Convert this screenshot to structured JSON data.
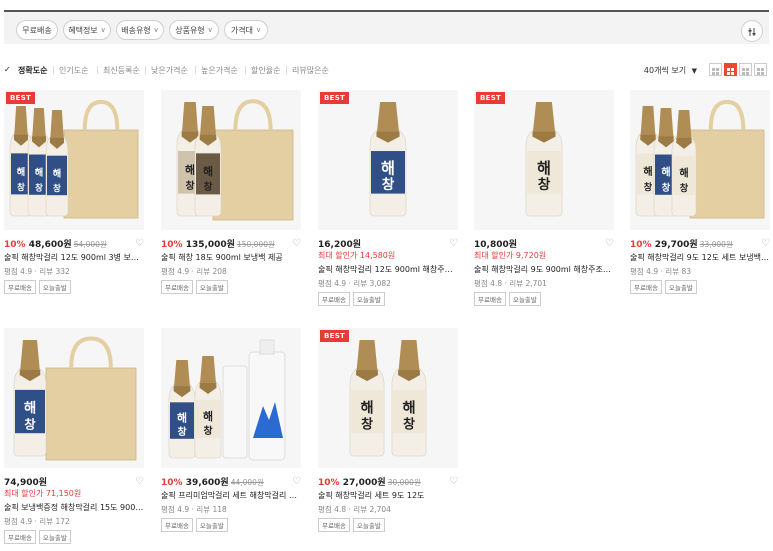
{
  "filters": [
    {
      "label": "무료배송",
      "chevron": false
    },
    {
      "label": "혜택정보",
      "chevron": true
    },
    {
      "label": "배송유형",
      "chevron": true
    },
    {
      "label": "상품유형",
      "chevron": true
    },
    {
      "label": "가격대",
      "chevron": true
    }
  ],
  "sort": {
    "options": [
      "정확도순",
      "인기도순",
      "최신등록순",
      "낮은가격순",
      "높은가격순",
      "할인율순",
      "리뷰많은순"
    ],
    "active": "정확도순",
    "per_page": "40개씩 보기"
  },
  "products": [
    {
      "best": "BEST",
      "discount": "10%",
      "price": "48,600원",
      "original": "54,000원",
      "max_label": "",
      "max_value": "",
      "name": "술픽 해창막걸리 12도 900ml 3병 보냉백...",
      "rating": "평점 4.9",
      "reviews": "리뷰 332",
      "tags": [
        "무료배송",
        "오늘출발"
      ],
      "image": "bag3"
    },
    {
      "best": "",
      "discount": "10%",
      "price": "135,000원",
      "original": "150,000원",
      "max_label": "",
      "max_value": "",
      "name": "술픽 해창 18도 900ml 보냉백 제공",
      "rating": "평점 4.9",
      "reviews": "리뷰 208",
      "tags": [
        "무료배송",
        "오늘출발"
      ],
      "image": "bag2dark"
    },
    {
      "best": "BEST",
      "discount": "",
      "price": "16,200원",
      "original": "",
      "max_label": "최대 할인가",
      "max_value": "14,580원",
      "name": "술픽 해창막걸리 12도 900ml 해창주조...",
      "rating": "평점 4.9",
      "reviews": "리뷰 3,082",
      "tags": [
        "무료배송",
        "오늘출발"
      ],
      "image": "single-blue"
    },
    {
      "best": "BEST",
      "discount": "",
      "price": "10,800원",
      "original": "",
      "max_label": "최대 할인가",
      "max_value": "9,720원",
      "name": "술픽 해창막걸리 9도 900ml 해창주조장 ...",
      "rating": "평점 4.8",
      "reviews": "리뷰 2,701",
      "tags": [
        "무료배송",
        "오늘출발"
      ],
      "image": "single-white"
    },
    {
      "best": "",
      "discount": "10%",
      "price": "29,700원",
      "original": "33,000원",
      "max_label": "",
      "max_value": "",
      "name": "술픽 해창막걸리 9도 12도 세트 보냉백 ...",
      "rating": "평점 4.9",
      "reviews": "리뷰 83",
      "tags": [
        "무료배송",
        "오늘출발"
      ],
      "image": "bag-mix"
    },
    {
      "best": "",
      "discount": "",
      "price": "74,900원",
      "original": "",
      "max_label": "최대 할인가",
      "max_value": "71,150원",
      "name": "술픽 보냉백증정 해창막걸리 15도 900m...",
      "rating": "평점 4.9",
      "reviews": "리뷰 172",
      "tags": [
        "무료배송",
        "오늘출발"
      ],
      "image": "bag1blue"
    },
    {
      "best": "",
      "discount": "10%",
      "price": "39,600원",
      "original": "44,000원",
      "max_label": "",
      "max_value": "",
      "name": "술픽 프리미엄막걸리 세트 해창막걸리 우...",
      "rating": "평점 4.9",
      "reviews": "리뷰 118",
      "tags": [
        "무료배송",
        "오늘출발"
      ],
      "image": "premium"
    },
    {
      "best": "BEST",
      "discount": "10%",
      "price": "27,000원",
      "original": "30,000원",
      "max_label": "",
      "max_value": "",
      "name": "술픽 해창막걸리 세트 9도 12도",
      "rating": "평점 4.8",
      "reviews": "리뷰 2,704",
      "tags": [
        "무료배송",
        "오늘출발"
      ],
      "image": "pair"
    }
  ],
  "colors": {
    "accent": "#e93a3a",
    "bag": "#e4cfa2",
    "bottle_blue": "#2f4f86",
    "bottle_white": "#efe7d8",
    "cap": "#b08d55"
  }
}
